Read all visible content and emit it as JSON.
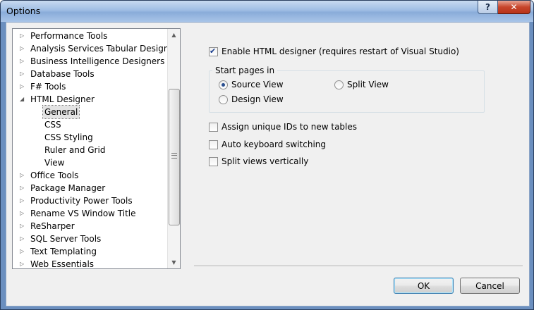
{
  "window": {
    "title": "Options",
    "help_glyph": "?",
    "close_glyph": "✕"
  },
  "tree": {
    "items": [
      {
        "label": "Performance Tools",
        "level": 0,
        "expanded": false
      },
      {
        "label": "Analysis Services Tabular Designers",
        "level": 0,
        "expanded": false
      },
      {
        "label": "Business Intelligence Designers",
        "level": 0,
        "expanded": false
      },
      {
        "label": "Database Tools",
        "level": 0,
        "expanded": false
      },
      {
        "label": "F# Tools",
        "level": 0,
        "expanded": false
      },
      {
        "label": "HTML Designer",
        "level": 0,
        "expanded": true
      },
      {
        "label": "General",
        "level": 1,
        "selected": true
      },
      {
        "label": "CSS",
        "level": 1
      },
      {
        "label": "CSS Styling",
        "level": 1
      },
      {
        "label": "Ruler and Grid",
        "level": 1
      },
      {
        "label": "View",
        "level": 1
      },
      {
        "label": "Office Tools",
        "level": 0,
        "expanded": false
      },
      {
        "label": "Package Manager",
        "level": 0,
        "expanded": false
      },
      {
        "label": "Productivity Power Tools",
        "level": 0,
        "expanded": false
      },
      {
        "label": "Rename VS Window Title",
        "level": 0,
        "expanded": false
      },
      {
        "label": "ReSharper",
        "level": 0,
        "expanded": false
      },
      {
        "label": "SQL Server Tools",
        "level": 0,
        "expanded": false
      },
      {
        "label": "Text Templating",
        "level": 0,
        "expanded": false
      },
      {
        "label": "Web Essentials",
        "level": 0,
        "expanded": false
      }
    ],
    "collapsed_arrow": "▷",
    "expanded_arrow": "◢",
    "scroll_up": "▲",
    "scroll_down": "▼"
  },
  "settings": {
    "enable_html_designer": {
      "label": "Enable HTML designer (requires restart of Visual Studio)",
      "checked": true
    },
    "start_pages": {
      "title": "Start pages in",
      "options": [
        {
          "label": "Source View",
          "selected": true
        },
        {
          "label": "Split View",
          "selected": false
        },
        {
          "label": "Design View",
          "selected": false
        }
      ]
    },
    "assign_unique_ids": {
      "label": "Assign unique IDs to new tables",
      "checked": false
    },
    "auto_keyboard_switching": {
      "label": "Auto keyboard switching",
      "checked": false
    },
    "split_views_vertically": {
      "label": "Split views vertically",
      "checked": false
    }
  },
  "buttons": {
    "ok": "OK",
    "cancel": "Cancel"
  }
}
